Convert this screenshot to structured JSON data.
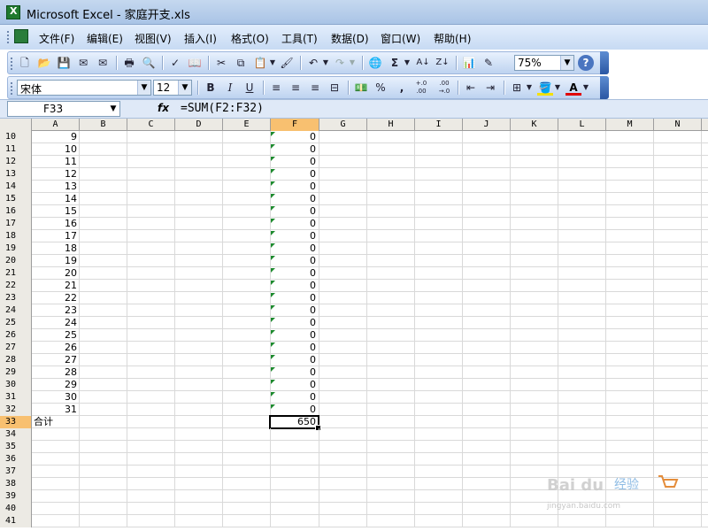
{
  "window": {
    "title": "Microsoft Excel - 家庭开支.xls"
  },
  "menu": [
    "文件(F)",
    "编辑(E)",
    "视图(V)",
    "插入(I)",
    "格式(O)",
    "工具(T)",
    "数据(D)",
    "窗口(W)",
    "帮助(H)"
  ],
  "toolbar": {
    "zoom": "75%",
    "sum_symbol": "Σ"
  },
  "format": {
    "font": "宋体",
    "size": "12",
    "bold": "B",
    "italic": "I",
    "underline": "U",
    "percent": "%",
    "comma": ",",
    "inc_decimal": "+.0 .00",
    "dec_decimal": ".00 →.0"
  },
  "formula_bar": {
    "cell": "F33",
    "fx": "fx",
    "formula": "=SUM(F2:F32)"
  },
  "columns": [
    "A",
    "B",
    "C",
    "D",
    "E",
    "F",
    "G",
    "H",
    "I",
    "J",
    "K",
    "L",
    "M",
    "N"
  ],
  "rows": [
    {
      "n": "10",
      "a": "9",
      "f": "0"
    },
    {
      "n": "11",
      "a": "10",
      "f": "0"
    },
    {
      "n": "12",
      "a": "11",
      "f": "0"
    },
    {
      "n": "13",
      "a": "12",
      "f": "0"
    },
    {
      "n": "14",
      "a": "13",
      "f": "0"
    },
    {
      "n": "15",
      "a": "14",
      "f": "0"
    },
    {
      "n": "16",
      "a": "15",
      "f": "0"
    },
    {
      "n": "17",
      "a": "16",
      "f": "0"
    },
    {
      "n": "18",
      "a": "17",
      "f": "0"
    },
    {
      "n": "19",
      "a": "18",
      "f": "0"
    },
    {
      "n": "20",
      "a": "19",
      "f": "0"
    },
    {
      "n": "21",
      "a": "20",
      "f": "0"
    },
    {
      "n": "22",
      "a": "21",
      "f": "0"
    },
    {
      "n": "23",
      "a": "22",
      "f": "0"
    },
    {
      "n": "24",
      "a": "23",
      "f": "0"
    },
    {
      "n": "25",
      "a": "24",
      "f": "0"
    },
    {
      "n": "26",
      "a": "25",
      "f": "0"
    },
    {
      "n": "27",
      "a": "26",
      "f": "0"
    },
    {
      "n": "28",
      "a": "27",
      "f": "0"
    },
    {
      "n": "29",
      "a": "28",
      "f": "0"
    },
    {
      "n": "30",
      "a": "29",
      "f": "0"
    },
    {
      "n": "31",
      "a": "30",
      "f": "0"
    },
    {
      "n": "32",
      "a": "31",
      "f": "0"
    },
    {
      "n": "33",
      "a": "合计",
      "f": "650"
    },
    {
      "n": "34",
      "a": "",
      "f": ""
    },
    {
      "n": "35",
      "a": "",
      "f": ""
    },
    {
      "n": "36",
      "a": "",
      "f": ""
    },
    {
      "n": "37",
      "a": "",
      "f": ""
    },
    {
      "n": "38",
      "a": "",
      "f": ""
    },
    {
      "n": "39",
      "a": "",
      "f": ""
    },
    {
      "n": "40",
      "a": "",
      "f": ""
    },
    {
      "n": "41",
      "a": "",
      "f": ""
    }
  ],
  "watermark": {
    "brand": "Bai du",
    "site": "jingyan.baidu.com",
    "label": "经验"
  }
}
